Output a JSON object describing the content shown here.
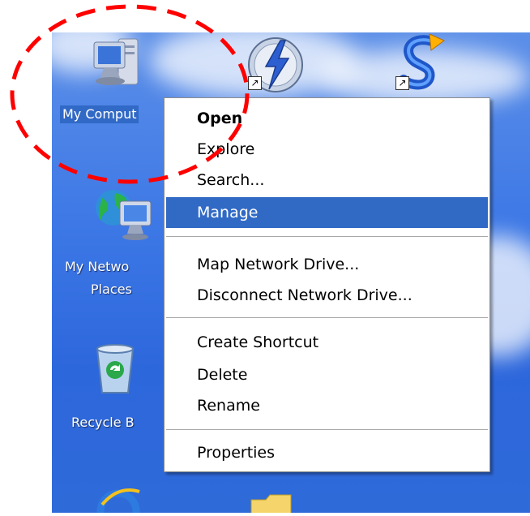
{
  "desktop": {
    "icons": [
      {
        "id": "my-computer",
        "label": "My Comput",
        "selected": true
      },
      {
        "id": "my-network-places",
        "label_line1": "My Netwo",
        "label_line2": "Places"
      },
      {
        "id": "recycle-bin",
        "label": "Recycle B"
      }
    ],
    "shortcut_arrow": "↗"
  },
  "context_menu": {
    "items": [
      {
        "label": "Open",
        "bold": true
      },
      {
        "label": "Explore"
      },
      {
        "label": "Search..."
      },
      {
        "label": "Manage",
        "highlighted": true
      },
      {
        "label": "Map Network Drive..."
      },
      {
        "label": "Disconnect Network Drive..."
      },
      {
        "label": "Create Shortcut"
      },
      {
        "label": "Delete"
      },
      {
        "label": "Rename"
      },
      {
        "label": "Properties"
      }
    ]
  },
  "colors": {
    "desktop_blue": "#3d78e6",
    "menu_highlight": "#316ac5",
    "annotation_red": "#ff0000"
  }
}
